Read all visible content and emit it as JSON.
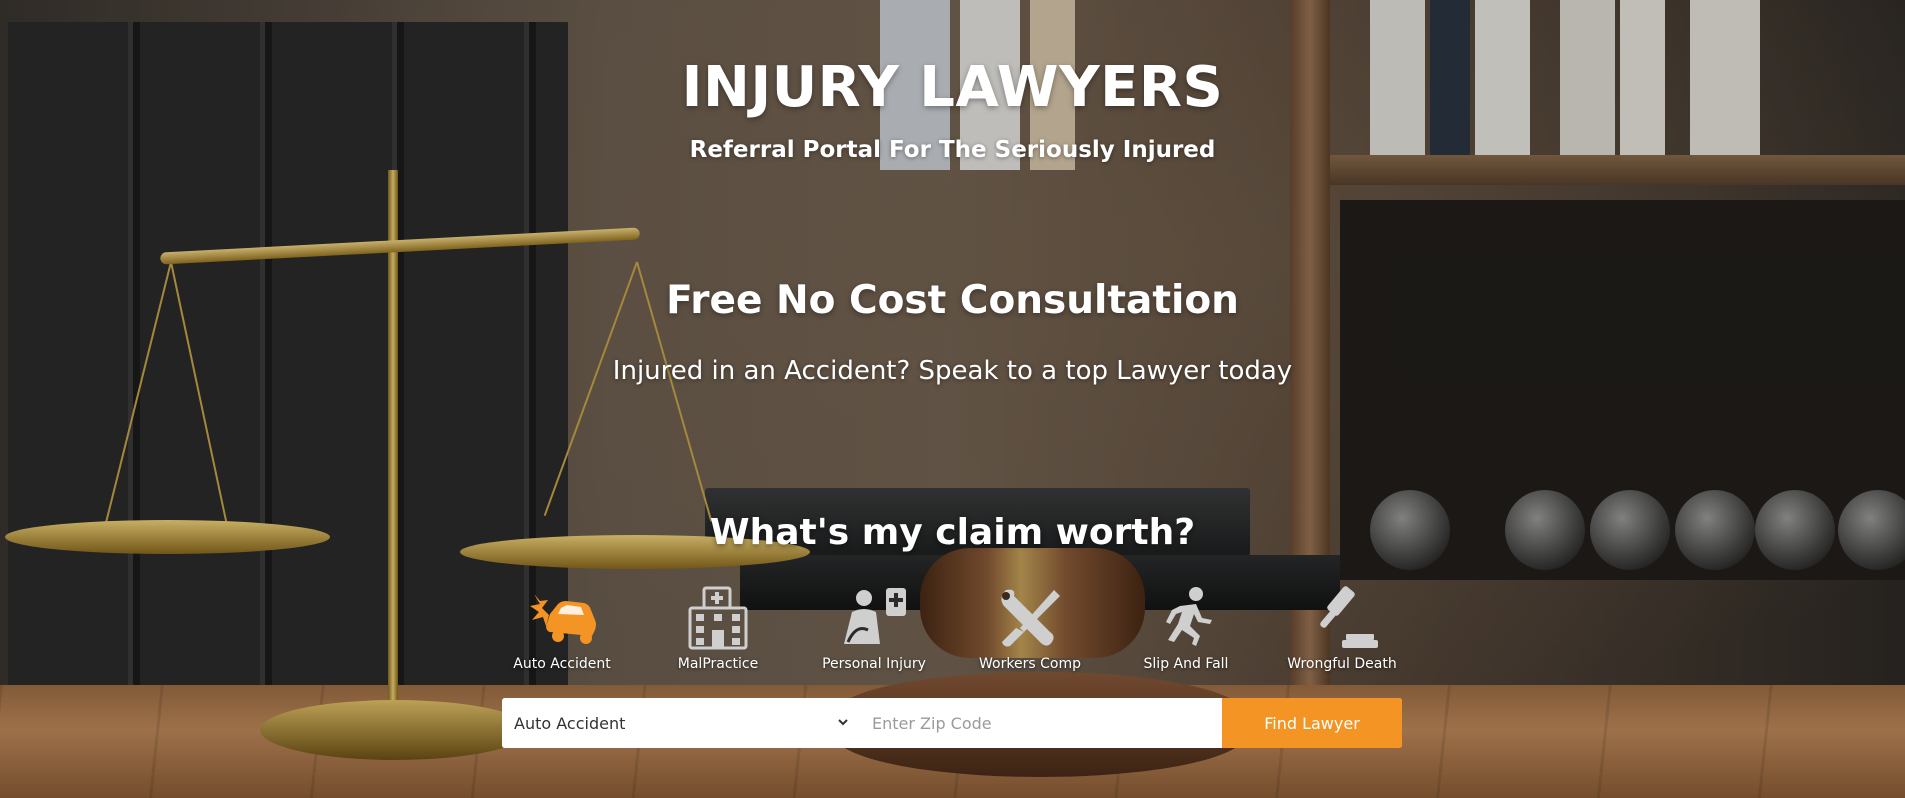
{
  "header": {
    "title": "INJURY LAWYERS",
    "subtitle": "Referral Portal For The Seriously Injured"
  },
  "consultation": {
    "title": "Free No Cost Consultation",
    "subtitle": "Injured in an Accident? Speak to a top Lawyer today"
  },
  "claim": {
    "title": "What's my claim worth?"
  },
  "categories": [
    {
      "label": "Auto Accident",
      "icon": "car-crash-icon",
      "active": true
    },
    {
      "label": "MalPractice",
      "icon": "hospital-icon",
      "active": false
    },
    {
      "label": "Personal Injury",
      "icon": "injured-person-icon",
      "active": false
    },
    {
      "label": "Workers Comp",
      "icon": "wrench-screwdriver-icon",
      "active": false
    },
    {
      "label": "Slip And Fall",
      "icon": "running-person-icon",
      "active": false
    },
    {
      "label": "Wrongful Death",
      "icon": "gavel-icon",
      "active": false
    }
  ],
  "search": {
    "selected_case": "Auto Accident",
    "zip_placeholder": "Enter Zip Code",
    "zip_value": "",
    "button_label": "Find Lawyer"
  },
  "colors": {
    "accent": "#f39424",
    "icon_inactive": "#cfcfcf",
    "text": "#ffffff"
  }
}
